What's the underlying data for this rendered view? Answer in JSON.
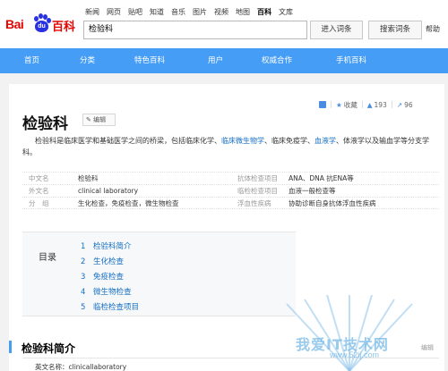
{
  "logo": {
    "part1": "Bai",
    "part2": "du",
    "part3": "百科"
  },
  "topnav": [
    "新闻",
    "网页",
    "贴吧",
    "知道",
    "音乐",
    "图片",
    "视频",
    "地图",
    "百科",
    "文库"
  ],
  "search": {
    "value": "检验科",
    "enter_label": "进入词条",
    "search_label": "搜索词条",
    "help_label": "帮助"
  },
  "mainnav": [
    "首页",
    "分类",
    "特色百科",
    "用户",
    "权威合作",
    "手机百科"
  ],
  "toolbar": {
    "collect_label": "收藏",
    "like_count": "193",
    "share_count": "96"
  },
  "entry": {
    "title": "检验科",
    "edit_label": "编辑",
    "summary": {
      "p1": "检验科是临床医学和基础医学之间的桥梁，包括临床化学、",
      "link1": "临床微生物学",
      "p2": "、临床免疫学、",
      "link2": "血液学",
      "p3": "、体液学以及输血学等分支学科。"
    }
  },
  "basic_info": [
    {
      "k1": "中文名",
      "v1": "检验科",
      "k2": "抗体检查项目",
      "v2": "ANA、DNA 抗ENA等"
    },
    {
      "k1": "外文名",
      "v1": "clinical laboratory",
      "k2": "临检检查项目",
      "v2": "血液一般检查等"
    },
    {
      "k1": "分　组",
      "v1": "生化检查，免疫检查，微生物检查",
      "k2": "浮血性疾病",
      "v2": "协助诊断自身抗体浮血性疾病"
    }
  ],
  "catalog": {
    "title": "目录",
    "items": [
      {
        "num": "1",
        "label": "检验科简介"
      },
      {
        "num": "2",
        "label": "生化检查"
      },
      {
        "num": "3",
        "label": "免疫检查"
      },
      {
        "num": "4",
        "label": "微生物检查"
      },
      {
        "num": "5",
        "label": "临检检查项目"
      }
    ]
  },
  "section": {
    "title": "检验科简介",
    "edit_label": "编辑",
    "first_line": "英文名称：clinicallaboratory"
  },
  "watermark": {
    "text": "我爱IT技术网",
    "url": "www.52ij.com"
  },
  "colors": {
    "nav_blue": "#459df5",
    "link_blue": "#136ec2",
    "brand_red": "#e10602",
    "paw_blue": "#2932e1"
  }
}
